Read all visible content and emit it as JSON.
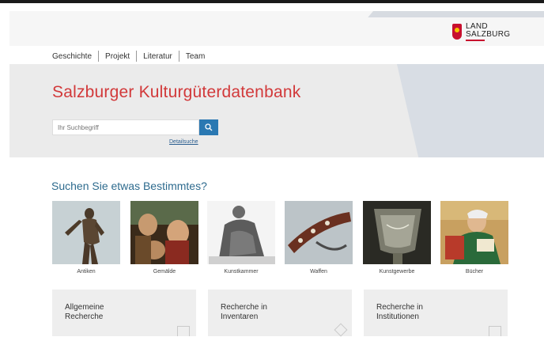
{
  "logo": {
    "text_line1": "LAND",
    "text_line2": "SALZBURG"
  },
  "nav": {
    "items": [
      "Geschichte",
      "Projekt",
      "Literatur",
      "Team"
    ]
  },
  "hero": {
    "title": "Salzburger Kulturgüterdatenbank",
    "search_placeholder": "Ihr Suchbegriff",
    "detail_link": "Detailsuche"
  },
  "categories": {
    "heading": "Suchen Sie etwas Bestimmtes?",
    "items": [
      {
        "label": "Antiken",
        "icon": "bronze-statue-image"
      },
      {
        "label": "Gemälde",
        "icon": "painting-image"
      },
      {
        "label": "Kunstkammer",
        "icon": "sculpture-image"
      },
      {
        "label": "Waffen",
        "icon": "weapon-image"
      },
      {
        "label": "Kunstgewerbe",
        "icon": "glass-goblet-image"
      },
      {
        "label": "Bücher",
        "icon": "book-illustration-image"
      }
    ]
  },
  "cards": [
    {
      "label": "Allgemeine\nRecherche",
      "icon": "document-icon"
    },
    {
      "label": "Recherche in\nInventaren",
      "icon": "layers-icon"
    },
    {
      "label": "Recherche in\nInstitutionen",
      "icon": "calendar-icon"
    }
  ],
  "colors": {
    "title_red": "#d2393a",
    "accent_blue": "#2a78b2",
    "heading_blue": "#2e6b8e"
  }
}
